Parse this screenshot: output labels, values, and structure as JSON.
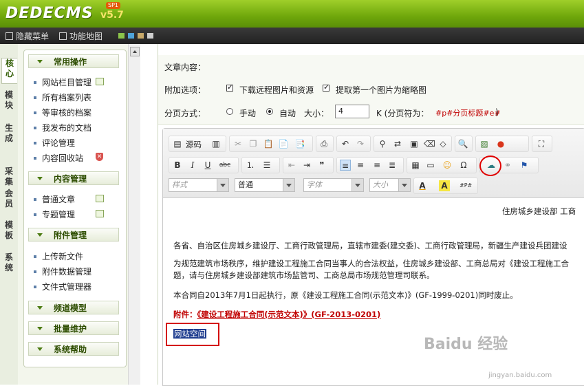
{
  "brand": {
    "logo": "DEDECMS",
    "version": "v5.7",
    "badge": "SP1"
  },
  "menubar": {
    "hide_menu": "隐藏菜单",
    "site_map": "功能地图"
  },
  "vtabs": [
    "核心",
    "模块",
    "生成",
    "采集",
    "会员",
    "模板",
    "系统"
  ],
  "sidebar": {
    "sections": [
      {
        "title": "常用操作",
        "items": [
          "网站栏目管理",
          "所有档案列表",
          "等审核的档案",
          "我发布的文档",
          "评论管理",
          "内容回收站"
        ]
      },
      {
        "title": "内容管理",
        "items": [
          "普通文章",
          "专题管理"
        ]
      },
      {
        "title": "附件管理",
        "items": [
          "上传新文件",
          "附件数据管理",
          "文件式管理器"
        ]
      },
      {
        "title": "频道模型",
        "items": []
      },
      {
        "title": "批量维护",
        "items": []
      },
      {
        "title": "系统帮助",
        "items": []
      }
    ]
  },
  "form": {
    "content_label": "文章内容：",
    "options_label": "附加选项：",
    "opt_download": "下载远程图片和资源",
    "opt_thumb": "提取第一个图片为缩略图",
    "paging_label": "分页方式：",
    "manual": "手动",
    "auto": "自动",
    "size_label": "大小：",
    "size_value": "4",
    "unit": "K (分页符为：",
    "page_token": "#p#分页标题#e#",
    "close_paren": ")"
  },
  "editor": {
    "source_btn": "源码",
    "style_dd": "样式",
    "format_dd": "普通",
    "font_dd": "字体",
    "size_dd": "大小",
    "lines": {
      "right_header": "住房城乡建设部 工商",
      "p1": "各省、自治区住房城乡建设厅、工商行政管理局，直辖市建委(建交委)、工商行政管理局，新疆生产建设兵团建设",
      "p2a": "为规范建筑市场秩序，维护建设工程施工合同当事人的合法权益，住房城乡建设部、工商总局对《建设工程施工合",
      "p2b": "题，请与住房城乡建设部建筑市场监管司、工商总局市场规范管理司联系。",
      "p3": "本合同自2013年7月1日起执行，原《建设工程施工合同(示范文本)》(GF-1999-0201)同时废止。",
      "attach_label": "附件：",
      "attach_link": "《建设工程施工合同(示范文本)》(GF-2013-0201)",
      "selected_text": "网站空间"
    }
  },
  "watermark": {
    "main": "Baidu 经验",
    "sub": "jingyan.baidu.com"
  },
  "colors": {
    "header_green": "#7ab316",
    "highlight_red": "#d40000",
    "link_red": "#c00000"
  }
}
